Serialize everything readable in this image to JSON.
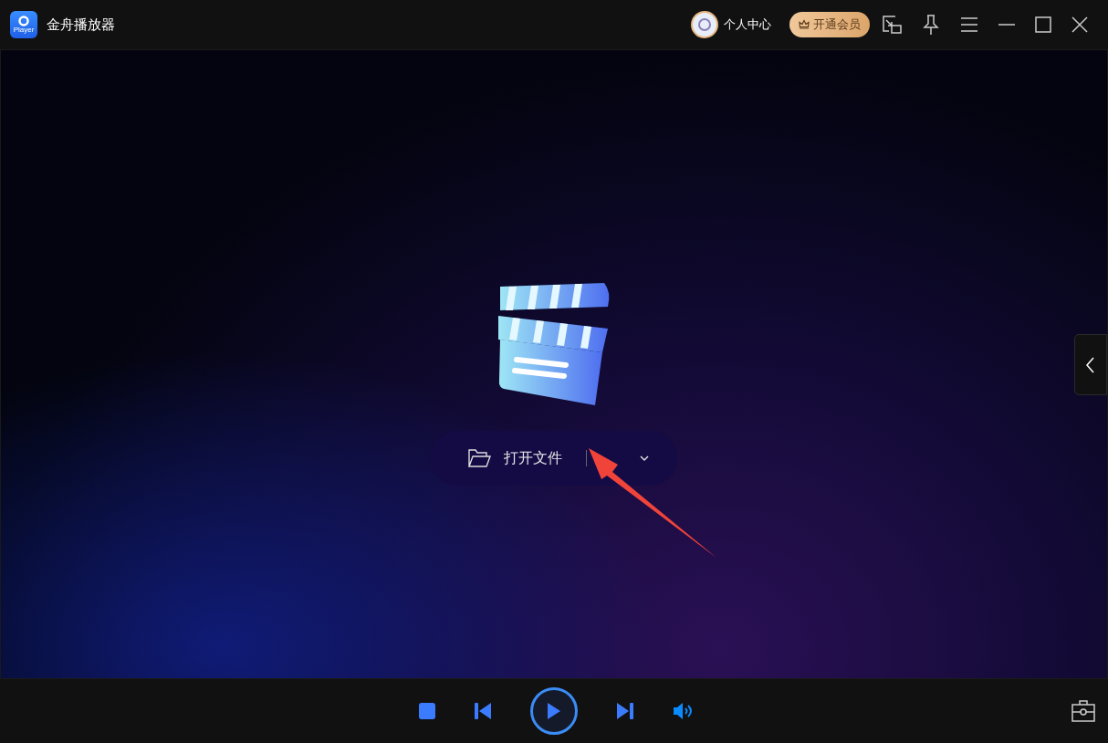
{
  "window": {
    "title": "金舟播放器",
    "logo_text": "Player"
  },
  "header": {
    "profile": "个人中心",
    "vip_button": "开通会员"
  },
  "open_button": {
    "label": "打开文件"
  },
  "controls": {
    "volume_muted": false
  }
}
